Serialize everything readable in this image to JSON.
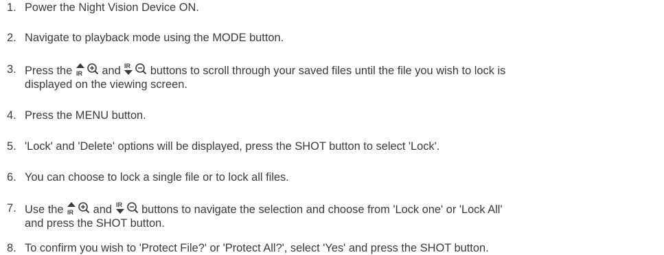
{
  "instructions": {
    "steps": [
      {
        "number": "1.",
        "text": "Power the Night Vision Device ON."
      },
      {
        "number": "2.",
        "text": "Navigate to playback mode using the MODE button."
      },
      {
        "number": "3.",
        "pre": "Press the ",
        "mid": " and ",
        "post": " buttons to scroll through your saved files until the file you wish to lock is",
        "line2": "displayed on the viewing screen."
      },
      {
        "number": "4.",
        "text": "Press the MENU button."
      },
      {
        "number": "5.",
        "text": "'Lock' and 'Delete' options will be displayed, press the SHOT button to select 'Lock'."
      },
      {
        "number": "6.",
        "text": "You can choose to lock a single file or to lock all files."
      },
      {
        "number": "7.",
        "pre": "Use the ",
        "mid": " and ",
        "post": " buttons to navigate the selection and choose from 'Lock one' or 'Lock All'",
        "line2": "and press the SHOT button."
      },
      {
        "number": "8.",
        "text": "To confirm you wish to 'Protect File?' or 'Protect All?', select 'Yes' and press the SHOT button."
      }
    ],
    "icons": {
      "up_label": "IR",
      "down_label": "IR",
      "up": "up-arrow-ir-zoom-in-icon",
      "down": "down-arrow-ir-zoom-out-icon"
    },
    "colors": {
      "text": "#3a3a3a"
    }
  }
}
